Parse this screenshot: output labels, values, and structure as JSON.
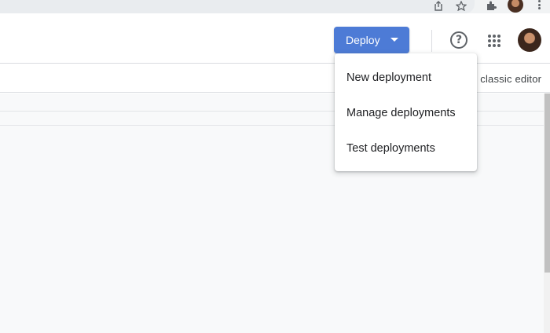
{
  "browser": {
    "icons": [
      "share-icon",
      "star-icon",
      "extensions-icon",
      "profile-avatar",
      "kebab-menu-icon"
    ]
  },
  "header": {
    "deploy_label": "Deploy",
    "help_icon_glyph": "?",
    "icons": [
      "help-icon",
      "apps-grid-icon",
      "account-avatar"
    ]
  },
  "toolbar": {
    "classic_editor_text": "e classic editor"
  },
  "deploy_menu": {
    "items": [
      {
        "label": "New deployment"
      },
      {
        "label": "Manage deployments"
      },
      {
        "label": "Test deployments"
      }
    ]
  },
  "colors": {
    "deploy_button": "#4d7bd6",
    "content_background": "#f8f9fa",
    "divider": "#dadce0"
  }
}
